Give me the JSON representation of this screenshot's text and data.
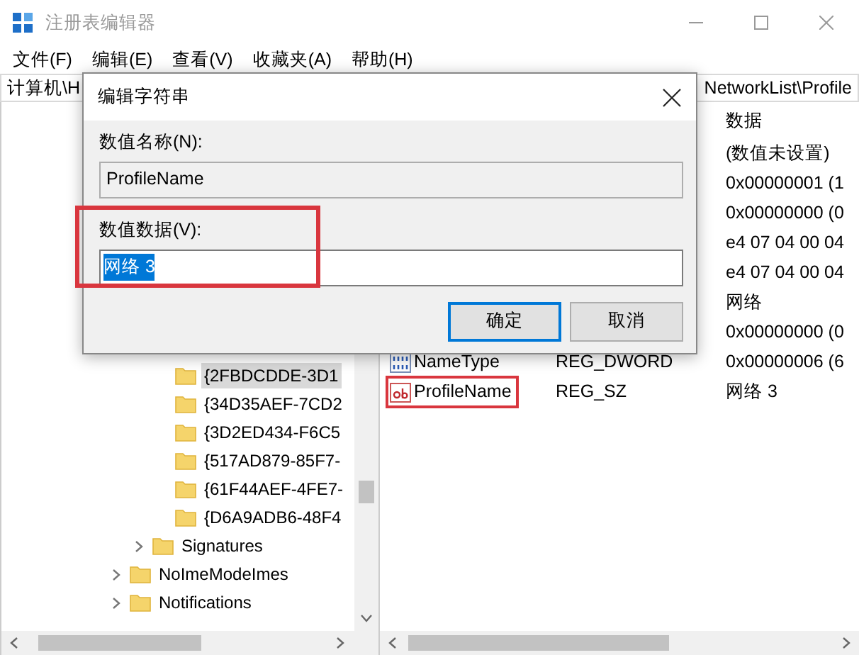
{
  "window": {
    "title": "注册表编辑器"
  },
  "menu": [
    {
      "label": "文件(F)"
    },
    {
      "label": "编辑(E)"
    },
    {
      "label": "查看(V)"
    },
    {
      "label": "收藏夹(A)"
    },
    {
      "label": "帮助(H)"
    }
  ],
  "address_bar": {
    "visible_start": "计算机\\H",
    "visible_end": "NetworkList\\Profile"
  },
  "tree": {
    "items": [
      {
        "children": [
          {
            "children": [
              {
                "label": "{2FBDCDDE-3D1",
                "selected": true
              },
              {
                "label": "{34D35AEF-7CD2",
                "selected": false
              },
              {
                "label": "{3D2ED434-F6C5",
                "selected": false
              },
              {
                "label": "{517AD879-85F7-",
                "selected": false
              },
              {
                "label": "{61F44AEF-4FE7-",
                "selected": false
              },
              {
                "label": "{D6A9ADB6-48F4",
                "selected": false
              }
            ]
          },
          {
            "label": "Signatures",
            "selected": false,
            "expanded": false
          }
        ]
      },
      {
        "label": "NoImeModeImes",
        "selected": false,
        "expanded": false
      },
      {
        "label": "Notifications",
        "selected": false,
        "expanded": false
      }
    ]
  },
  "values_list": {
    "data_header": "数据",
    "rows": [
      {
        "data": "(数值未设置)"
      },
      {
        "data": "0x00000001 (1"
      },
      {
        "data": "0x00000000 (0"
      },
      {
        "data": "e4 07 04 00 04"
      },
      {
        "data": "e4 07 04 00 04"
      },
      {
        "data": "网络"
      },
      {
        "data": "0x00000000 (0"
      },
      {
        "name": "NameType",
        "type": "REG_DWORD",
        "data": "0x00000006 (6",
        "kind": "dword",
        "annotated": false
      },
      {
        "name": "ProfileName",
        "type": "REG_SZ",
        "data": "网络 3",
        "kind": "string",
        "annotated": true
      }
    ]
  },
  "dialog": {
    "title": "编辑字符串",
    "name_label": "数值名称(N):",
    "name_value": "ProfileName",
    "data_label": "数值数据(V):",
    "data_value": "网络 3",
    "data_selected": true,
    "data_annotated": true,
    "buttons": [
      {
        "label": "确定",
        "default": true
      },
      {
        "label": "取消",
        "default": false
      }
    ]
  }
}
